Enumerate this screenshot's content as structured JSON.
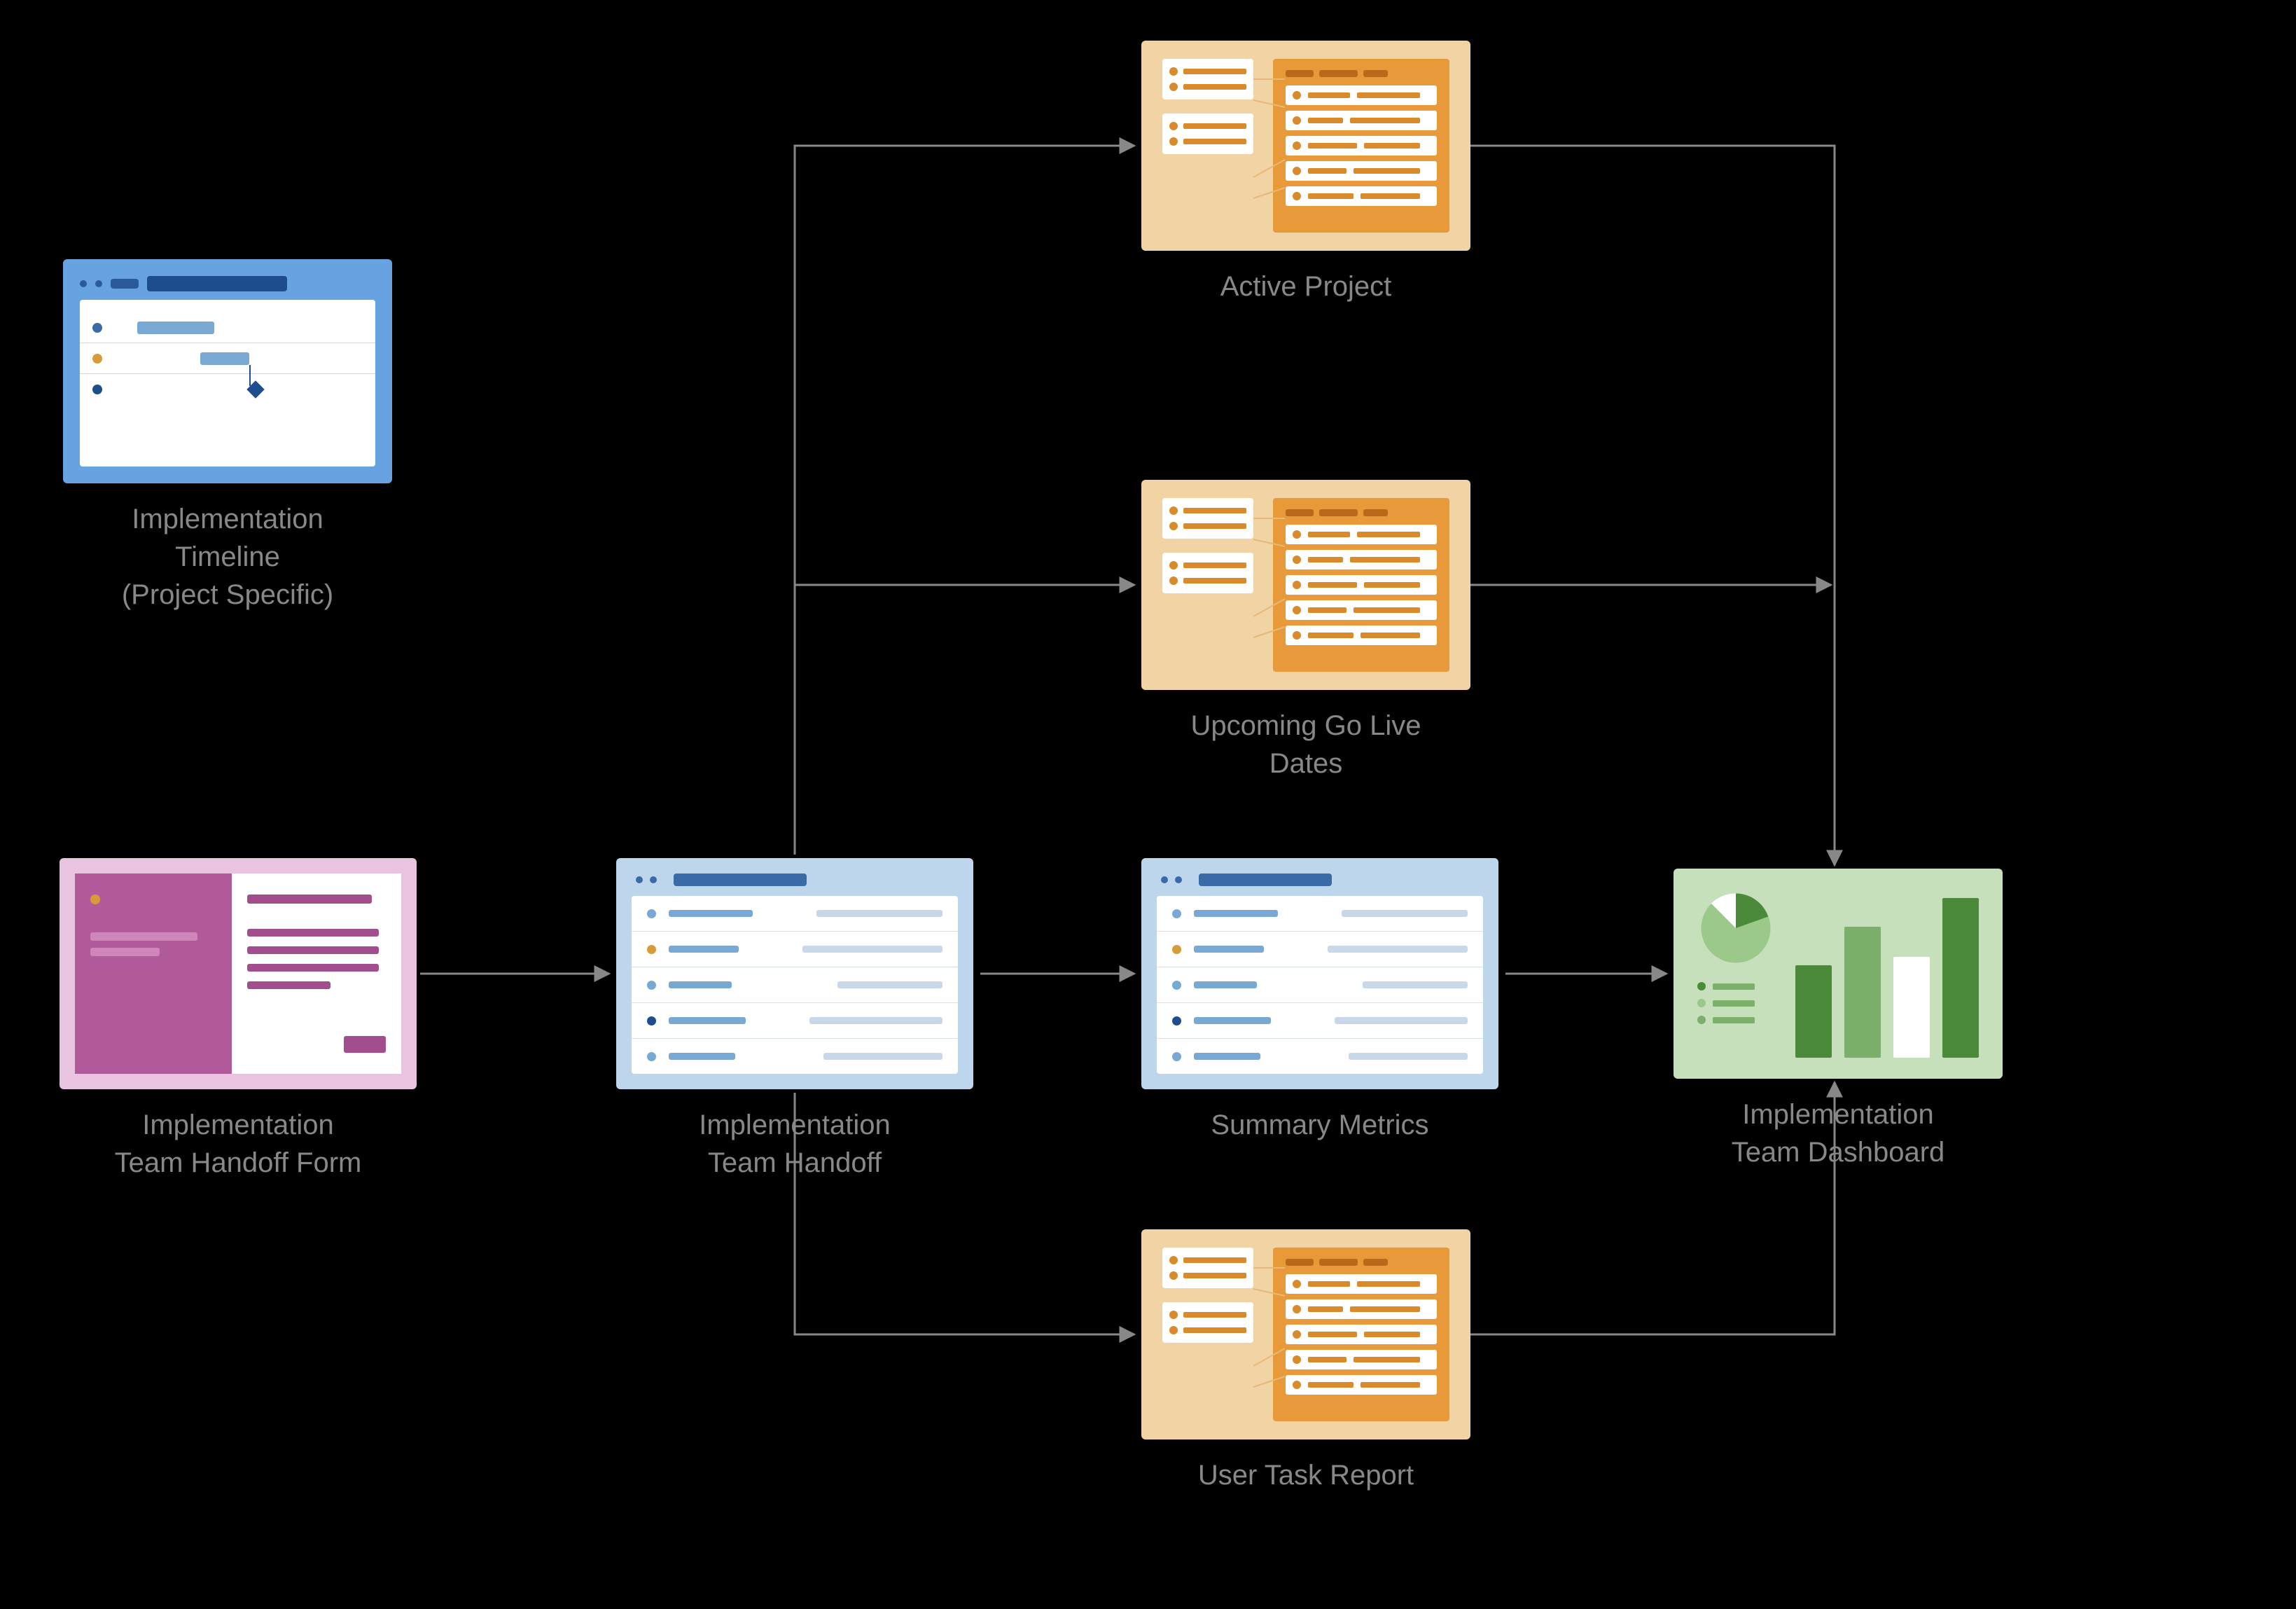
{
  "nodes": {
    "timeline": {
      "label": "Implementation\nTimeline\n(Project Specific)"
    },
    "handoff_form": {
      "label": "Implementation\nTeam Handoff Form"
    },
    "team_handoff": {
      "label": "Implementation\nTeam Handoff"
    },
    "summary_metrics": {
      "label": "Summary Metrics"
    },
    "active_project": {
      "label": "Active Project"
    },
    "go_live": {
      "label": "Upcoming Go Live\nDates"
    },
    "user_task": {
      "label": "User Task Report"
    },
    "dashboard": {
      "label": "Implementation\nTeam Dashboard"
    }
  },
  "colors": {
    "blue_dark": "#1d4d8c",
    "blue_mid": "#3a6ba8",
    "blue_light": "#bdd6ec",
    "orange_dark": "#b86a1a",
    "orange_mid": "#d98a2a",
    "orange_light": "#f2d3a3",
    "pink_dark": "#a14d8e",
    "pink_mid": "#b05a9a",
    "green_dark": "#4a8a3a",
    "green_mid": "#7ab069",
    "arrow": "#888"
  },
  "flow_edges": [
    [
      "handoff_form",
      "team_handoff"
    ],
    [
      "team_handoff",
      "active_project"
    ],
    [
      "team_handoff",
      "go_live"
    ],
    [
      "team_handoff",
      "summary_metrics"
    ],
    [
      "team_handoff",
      "user_task"
    ],
    [
      "active_project",
      "dashboard"
    ],
    [
      "go_live",
      "dashboard"
    ],
    [
      "summary_metrics",
      "dashboard"
    ],
    [
      "user_task",
      "dashboard"
    ]
  ]
}
